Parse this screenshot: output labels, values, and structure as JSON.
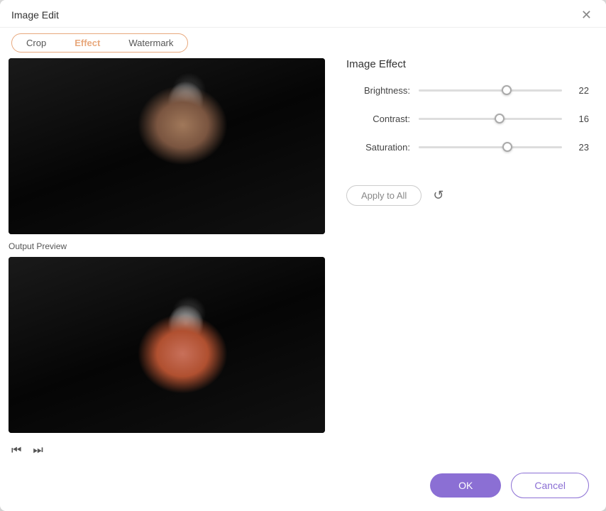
{
  "dialog": {
    "title": "Image Edit"
  },
  "tabs": {
    "items": [
      {
        "id": "crop",
        "label": "Crop",
        "active": false
      },
      {
        "id": "effect",
        "label": "Effect",
        "active": true
      },
      {
        "id": "watermark",
        "label": "Watermark",
        "active": false
      }
    ]
  },
  "effect_panel": {
    "title": "Image Effect",
    "sliders": [
      {
        "id": "brightness",
        "label": "Brightness:",
        "value": 22,
        "min": 0,
        "max": 100,
        "percent": 62
      },
      {
        "id": "contrast",
        "label": "Contrast:",
        "value": 16,
        "min": 0,
        "max": 100,
        "percent": 57
      },
      {
        "id": "saturation",
        "label": "Saturation:",
        "value": 23,
        "min": 0,
        "max": 100,
        "percent": 63
      }
    ],
    "apply_all_label": "Apply to All",
    "reset_icon": "↺"
  },
  "preview": {
    "output_label": "Output Preview"
  },
  "footer": {
    "ok_label": "OK",
    "cancel_label": "Cancel"
  },
  "icons": {
    "close": "✕",
    "prev": "⏮",
    "next": "⏭",
    "reset": "↺"
  }
}
